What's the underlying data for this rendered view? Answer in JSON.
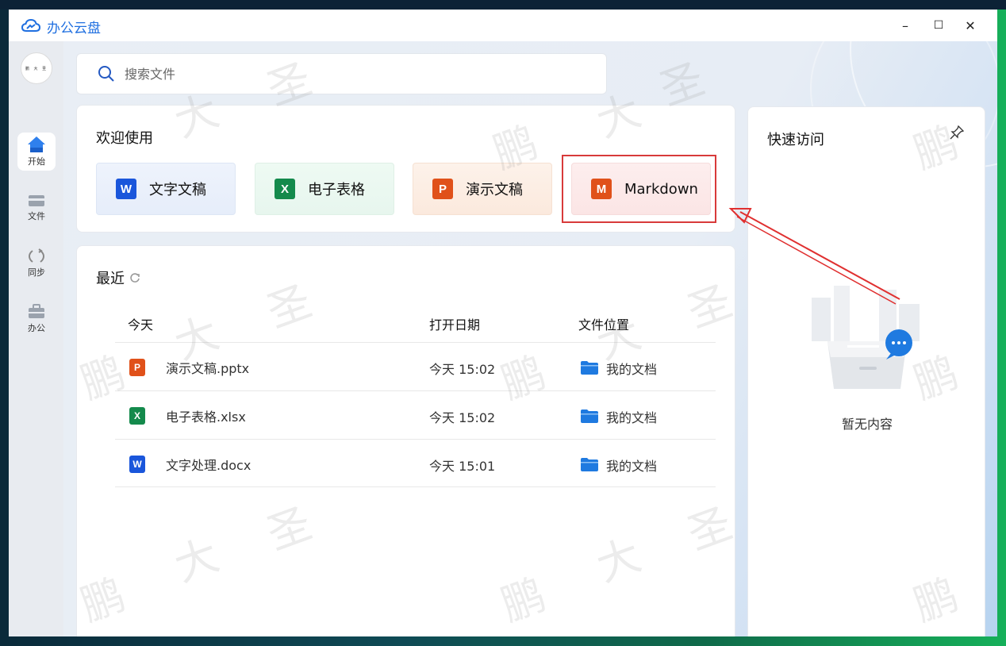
{
  "app": {
    "title": "办公云盘",
    "brand_color": "#1f6fe0"
  },
  "window_controls": {
    "minimize": "–",
    "maximize": "☐",
    "close": "✕"
  },
  "user": {
    "avatar_text": "鹏 大 圣"
  },
  "sidebar": {
    "items": [
      {
        "label": "开始",
        "icon": "home-icon",
        "active": true
      },
      {
        "label": "文件",
        "icon": "folder-icon",
        "active": false
      },
      {
        "label": "同步",
        "icon": "sync-icon",
        "active": false
      },
      {
        "label": "办公",
        "icon": "briefcase-icon",
        "active": false
      }
    ]
  },
  "search": {
    "placeholder": "搜索文件"
  },
  "welcome": {
    "title": "欢迎使用",
    "buttons": [
      {
        "label": "文字文稿",
        "icon_letter": "W",
        "color": "#1a56db"
      },
      {
        "label": "电子表格",
        "icon_letter": "X",
        "color": "#148a4c"
      },
      {
        "label": "演示文稿",
        "icon_letter": "P",
        "color": "#e0511a"
      },
      {
        "label": "Markdown",
        "icon_letter": "M",
        "color": "#e0511a"
      }
    ]
  },
  "recent": {
    "title": "最近",
    "columns": {
      "name": "今天",
      "date": "打开日期",
      "location": "文件位置"
    },
    "rows": [
      {
        "name": "演示文稿.pptx",
        "icon_letter": "P",
        "color": "#e0511a",
        "date": "今天 15:02",
        "location": "我的文档"
      },
      {
        "name": "电子表格.xlsx",
        "icon_letter": "X",
        "color": "#148a4c",
        "date": "今天 15:02",
        "location": "我的文档"
      },
      {
        "name": "文字处理.docx",
        "icon_letter": "W",
        "color": "#1a56db",
        "date": "今天 15:01",
        "location": "我的文档"
      }
    ]
  },
  "quick_access": {
    "title": "快速访问",
    "empty_text": "暂无内容"
  },
  "watermark": {
    "chars": [
      "鹏",
      "大",
      "圣"
    ]
  }
}
